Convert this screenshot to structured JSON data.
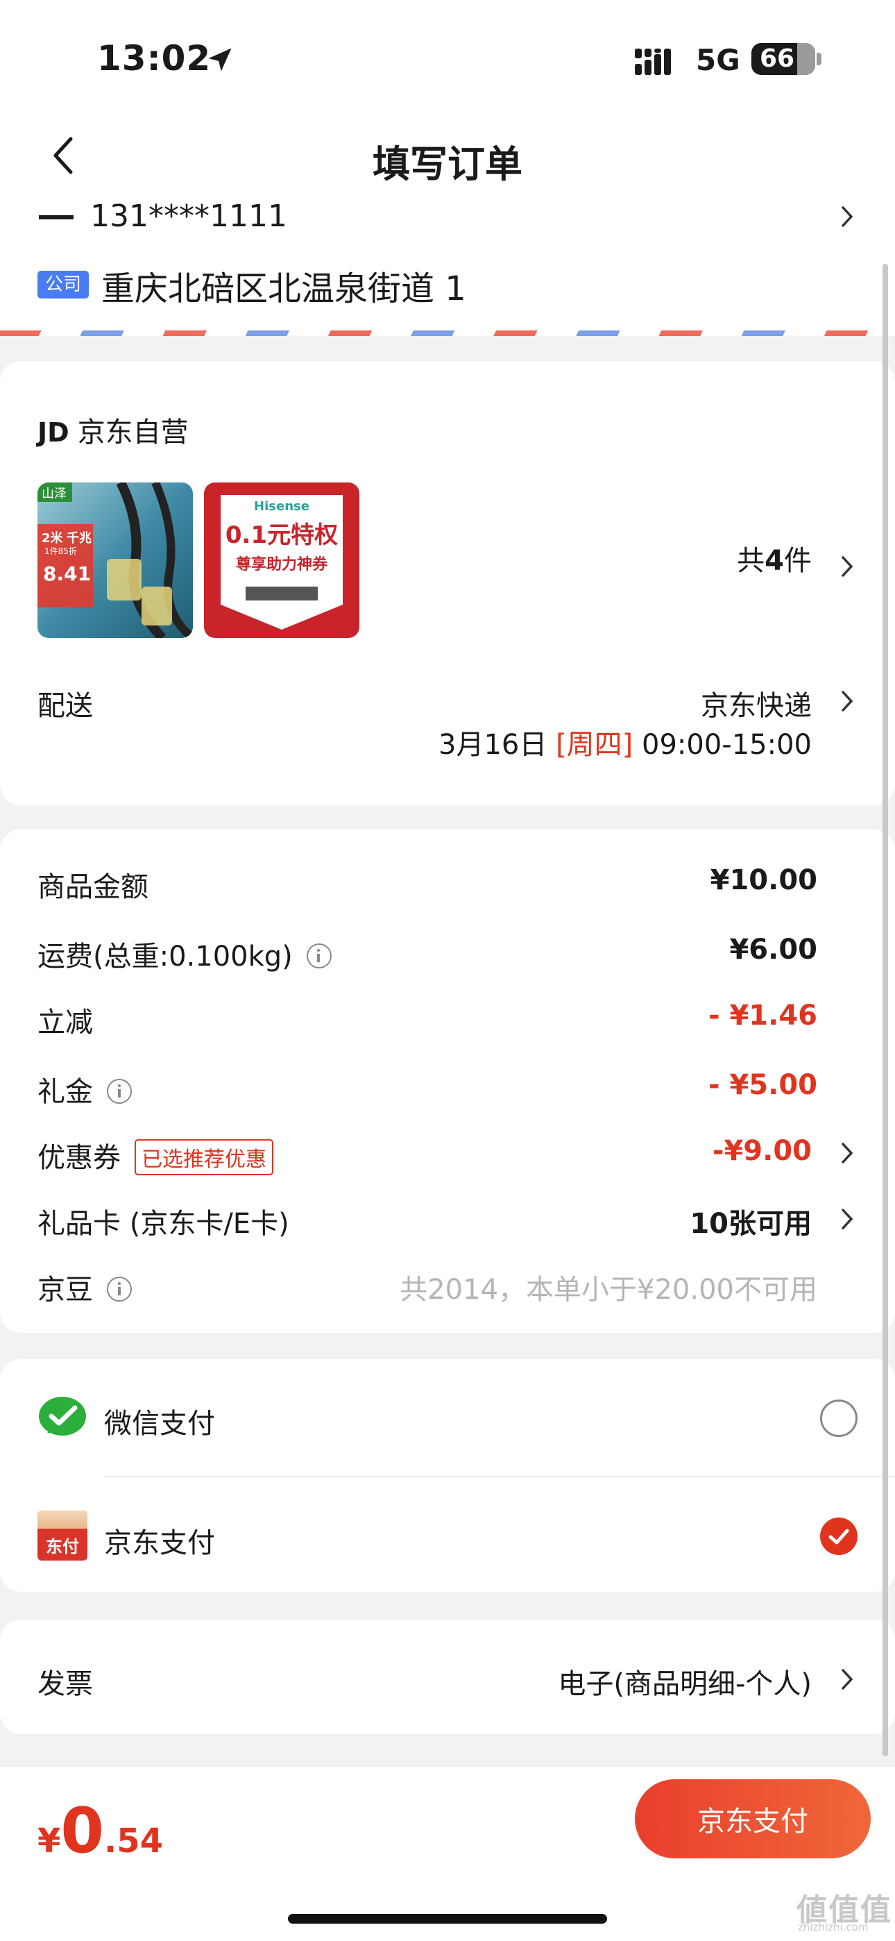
{
  "status_bar": {
    "time": "13:02",
    "network": "5G",
    "battery": "66"
  },
  "nav": {
    "title": "填写订单"
  },
  "address": {
    "phone": "131****1111",
    "tag": "公司",
    "line": "重庆北碚区北温泉街道 1"
  },
  "shop": {
    "logo": "JD",
    "name": "京东自营",
    "product1": {
      "brand": "山泽",
      "tag": "2米",
      "tag2": "千兆",
      "discount": "1件85折",
      "price": "8.41"
    },
    "product2": {
      "brand": "Hisense",
      "headline": "0.1元特权",
      "sub": "尊享助力神券"
    },
    "count_prefix": "共",
    "count": "4",
    "count_suffix": "件"
  },
  "delivery": {
    "label": "配送",
    "carrier": "京东快递",
    "date": "3月16日",
    "weekday": "[周四]",
    "time_window": "09:00-15:00"
  },
  "price_rows": [
    {
      "label": "商品金额",
      "value": "¥10.00"
    },
    {
      "label": "运费(总重:0.100kg)",
      "value": "¥6.00"
    },
    {
      "label": "立减",
      "value": "- ¥1.46"
    },
    {
      "label": "礼金",
      "value": "- ¥5.00"
    },
    {
      "label": "优惠券",
      "tag": "已选推荐优惠",
      "value": "-¥9.00"
    },
    {
      "label": "礼品卡 (京东卡/E卡)",
      "value": "10张可用"
    },
    {
      "label": "京豆",
      "value": "共2014，本单小于¥20.00不可用"
    }
  ],
  "payment": {
    "options": [
      {
        "label": "微信支付",
        "selected": false
      },
      {
        "label": "京东支付",
        "selected": true
      }
    ],
    "jd_icon_text": "东付"
  },
  "invoice": {
    "label": "发票",
    "value": "电子(商品明细-个人)"
  },
  "bottom": {
    "currency": "¥",
    "integer": "0",
    "decimal": ".54",
    "pay_button": "京东支付"
  },
  "watermark": {
    "text": "値值值",
    "sub": "zhizhizhi.com"
  },
  "colors": {
    "accent": "#e0341f",
    "wechat": "#2aae3c",
    "company_tag": "#4a7cf1"
  }
}
